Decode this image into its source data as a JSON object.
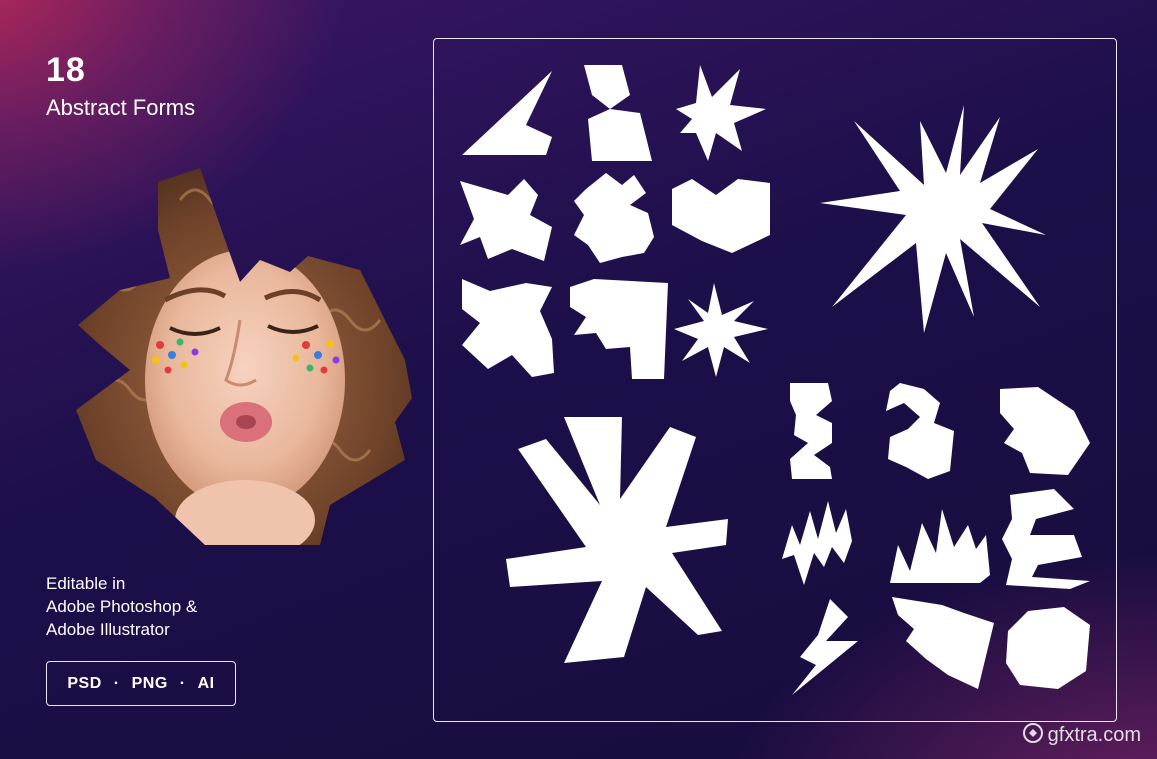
{
  "title": {
    "number": "18",
    "subtitle": "Abstract Forms"
  },
  "description": [
    "Editable in",
    "Adobe Photoshop &",
    "Adobe Illustrator"
  ],
  "formats": [
    "PSD",
    "PNG",
    "AI"
  ],
  "format_separator": "·",
  "watermark": "gfxtra.com",
  "colors": {
    "background": "#170c3c",
    "accent_top_left": "#c42a54",
    "shape_fill": "#ffffff"
  },
  "icons": [
    "watermark-logo-icon"
  ]
}
